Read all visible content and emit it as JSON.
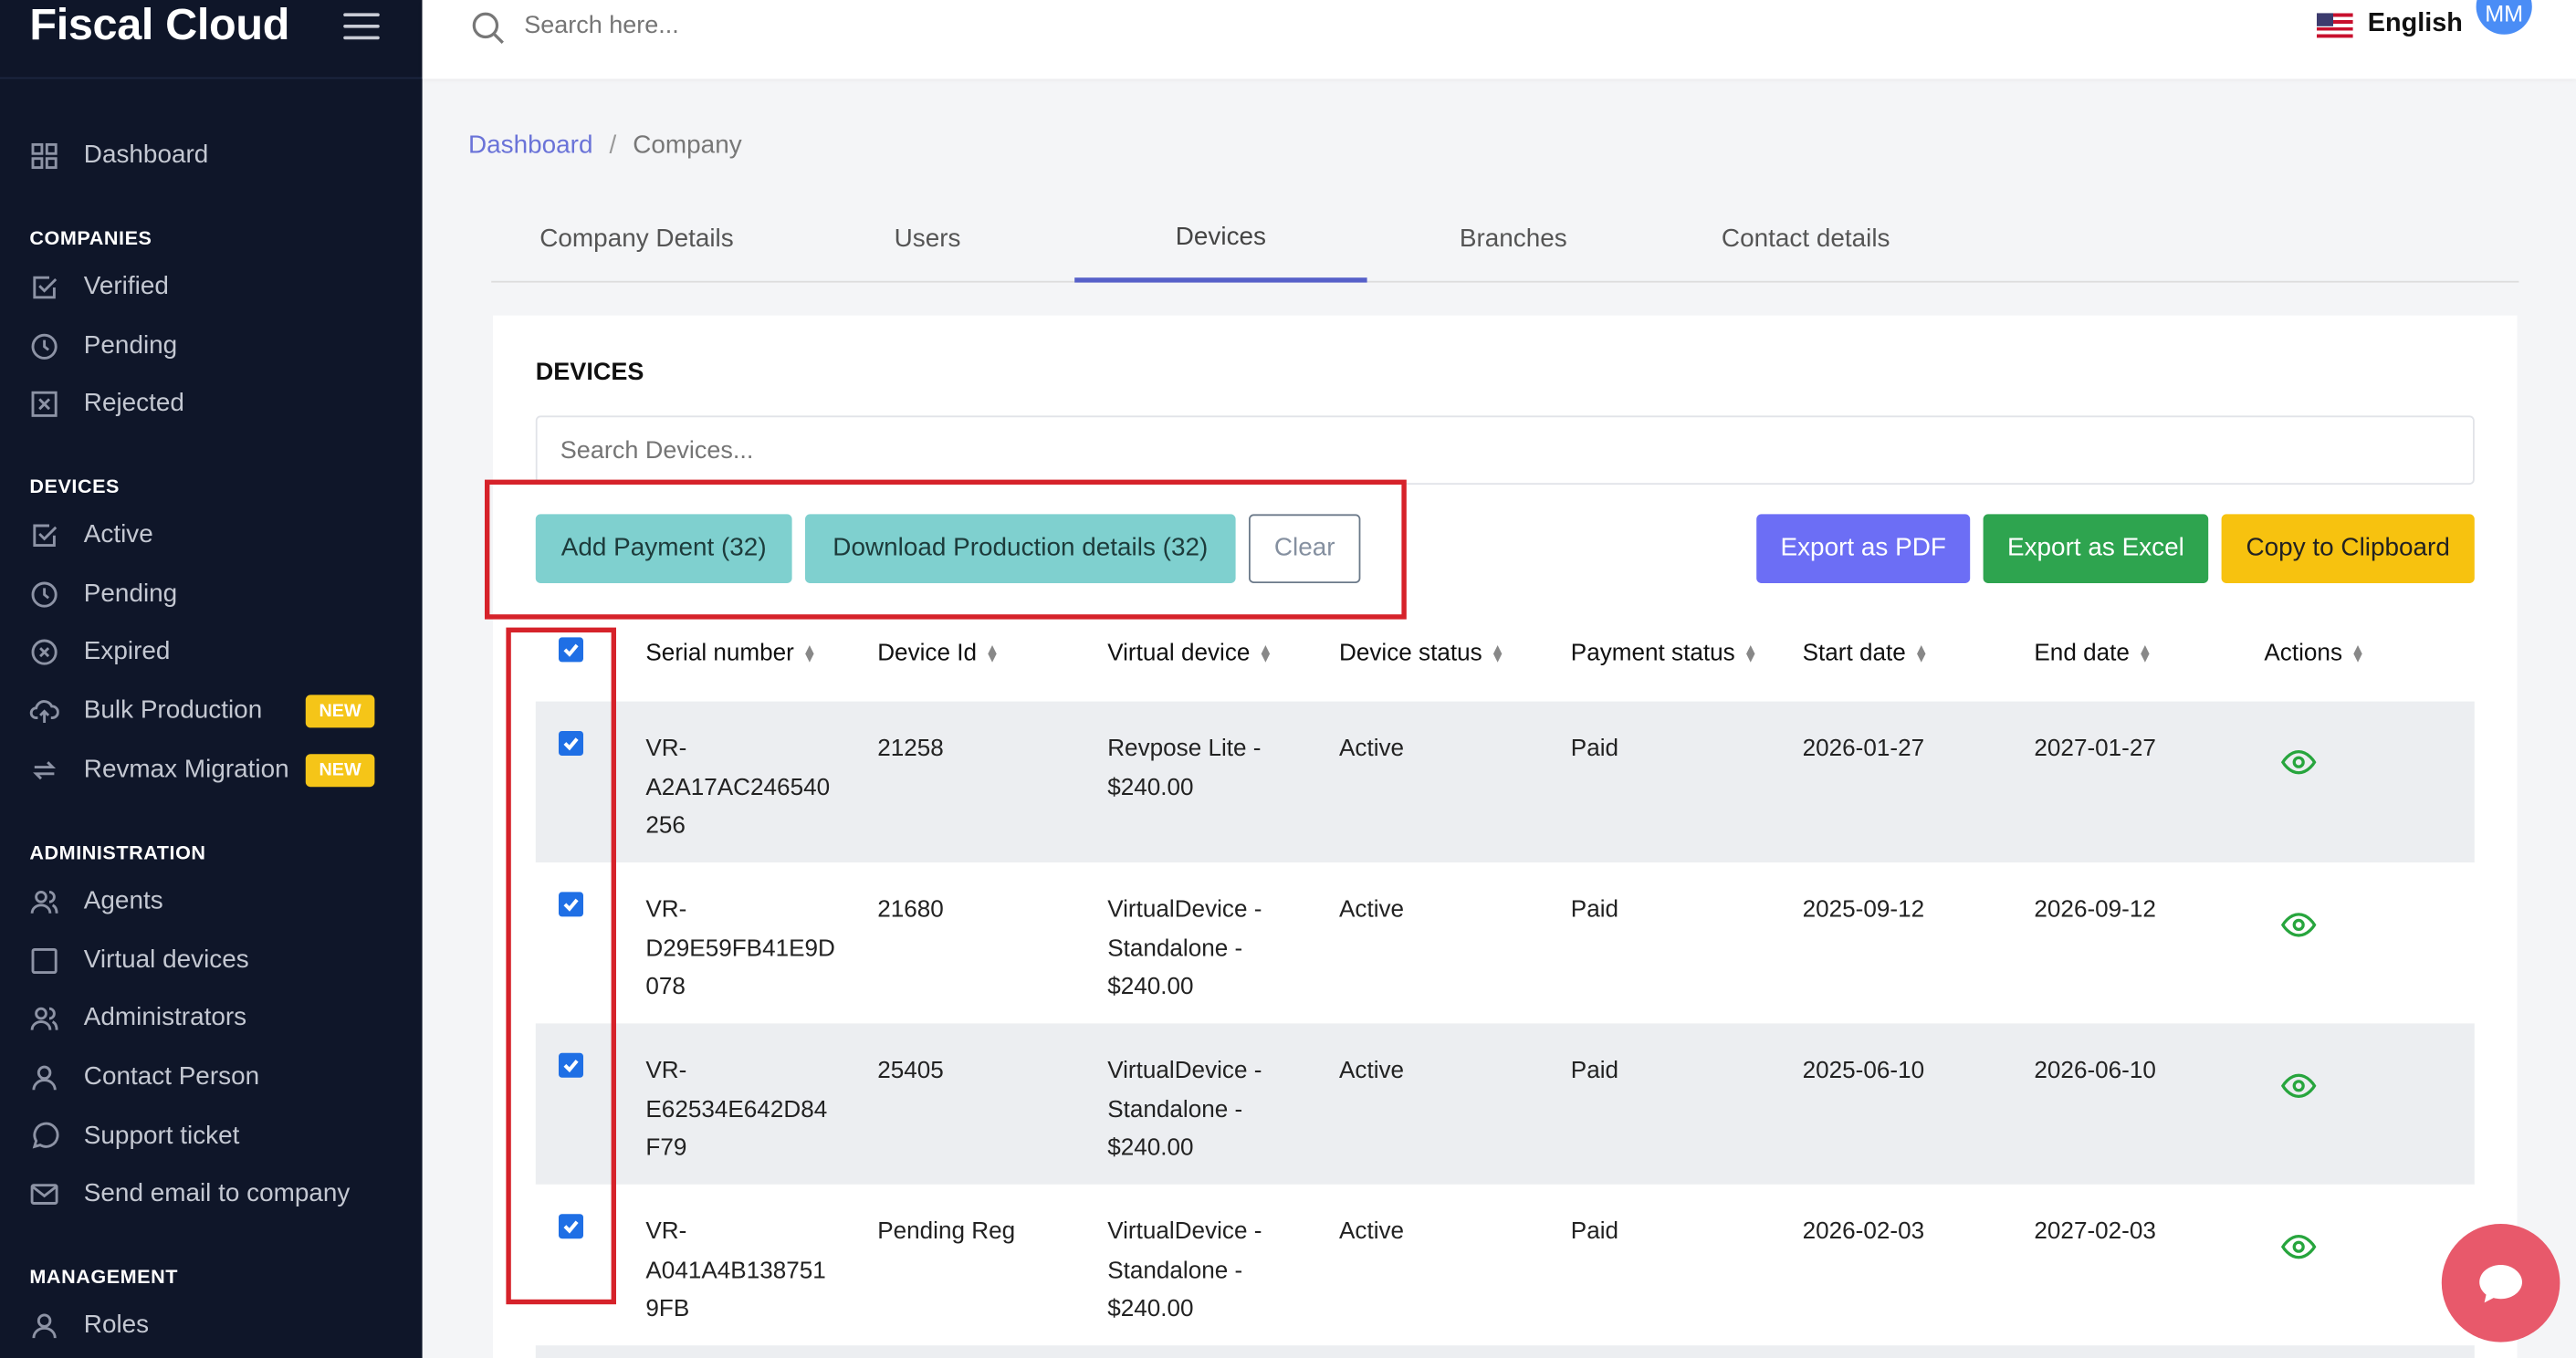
{
  "app": {
    "title": "Fiscal Cloud"
  },
  "topbar": {
    "search_placeholder": "Search here...",
    "language": "English",
    "avatar_initials": "MM"
  },
  "sidebar": {
    "dashboard": "Dashboard",
    "sections": {
      "companies": "COMPANIES",
      "devices": "DEVICES",
      "administration": "ADMINISTRATION",
      "management": "MANAGEMENT"
    },
    "companies": [
      "Verified",
      "Pending",
      "Rejected"
    ],
    "devices": [
      "Active",
      "Pending",
      "Expired",
      "Bulk Production",
      "Revmax Migration"
    ],
    "new_badge": "NEW",
    "administration": [
      "Agents",
      "Virtual devices",
      "Administrators",
      "Contact Person",
      "Support ticket",
      "Send email to company"
    ],
    "management": [
      "Roles"
    ]
  },
  "breadcrumb": {
    "root": "Dashboard",
    "separator": "/",
    "current": "Company"
  },
  "tabs": [
    "Company Details",
    "Users",
    "Devices",
    "Branches",
    "Contact details"
  ],
  "active_tab": "Devices",
  "devices": {
    "title": "DEVICES",
    "search_placeholder": "Search Devices...",
    "buttons": {
      "add_payment": "Add Payment (32)",
      "download": "Download Production details (32)",
      "clear": "Clear",
      "export_pdf": "Export as PDF",
      "export_excel": "Export as Excel",
      "copy": "Copy to Clipboard"
    },
    "columns": [
      "Serial number",
      "Device Id",
      "Virtual device",
      "Device status",
      "Payment status",
      "Start date",
      "End date",
      "Actions"
    ],
    "rows": [
      {
        "serial": [
          "VR-",
          "A2A17AC246540",
          "256"
        ],
        "device_id": "21258",
        "virtual": [
          "Revpose Lite -",
          "$240.00"
        ],
        "status": "Active",
        "payment": "Paid",
        "start": "2026-01-27",
        "end": "2027-01-27",
        "checked": true
      },
      {
        "serial": [
          "VR-",
          "D29E59FB41E9D",
          "078"
        ],
        "device_id": "21680",
        "virtual": [
          "VirtualDevice -",
          "Standalone -",
          "$240.00"
        ],
        "status": "Active",
        "payment": "Paid",
        "start": "2025-09-12",
        "end": "2026-09-12",
        "checked": true
      },
      {
        "serial": [
          "VR-",
          "E62534E642D84",
          "F79"
        ],
        "device_id": "25405",
        "virtual": [
          "VirtualDevice -",
          "Standalone -",
          "$240.00"
        ],
        "status": "Active",
        "payment": "Paid",
        "start": "2025-06-10",
        "end": "2026-06-10",
        "checked": true
      },
      {
        "serial": [
          "VR-",
          "A041A4B138751",
          "9FB"
        ],
        "device_id": "Pending Reg",
        "virtual": [
          "VirtualDevice -",
          "Standalone -",
          "$240.00"
        ],
        "status": "Active",
        "payment": "Paid",
        "start": "2026-02-03",
        "end": "2027-02-03",
        "checked": true
      }
    ]
  },
  "colors": {
    "sidebar_bg": "#0f1629",
    "accent": "#5660c9",
    "teal": "#7fd0cf",
    "pdf": "#6c6ef5",
    "excel": "#2ea44f",
    "clipboard": "#f7c20f",
    "highlight": "#d6222a",
    "new_badge": "#f5c518"
  }
}
